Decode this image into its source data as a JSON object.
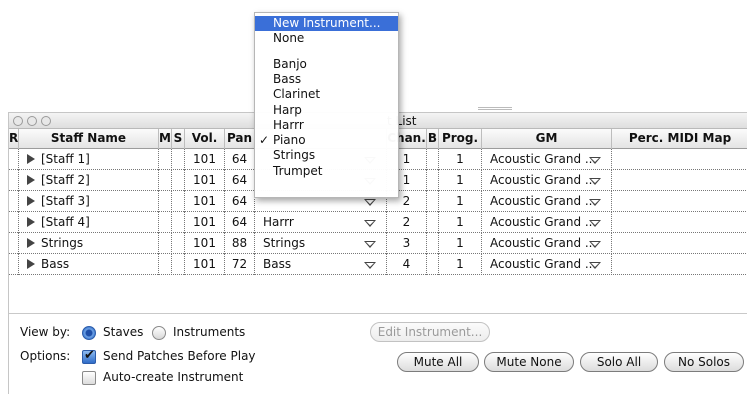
{
  "window": {
    "title": "t List"
  },
  "columns": {
    "r": "R",
    "staff_name": "Staff Name",
    "m": "M",
    "s": "S",
    "vol": "Vol.",
    "pan": "Pan",
    "chan": "Chan.",
    "b": "B",
    "prog": "Prog.",
    "gm": "GM",
    "perc": "Perc. MIDI Map"
  },
  "rows": [
    {
      "name": "[Staff 1]",
      "vol": "101",
      "pan": "64",
      "instrument": "",
      "chan": "1",
      "prog": "1",
      "gm": "Acoustic Grand ..."
    },
    {
      "name": "[Staff 2]",
      "vol": "101",
      "pan": "64",
      "instrument": "",
      "chan": "1",
      "prog": "1",
      "gm": "Acoustic Grand ..."
    },
    {
      "name": "[Staff 3]",
      "vol": "101",
      "pan": "64",
      "instrument": "",
      "chan": "2",
      "prog": "1",
      "gm": "Acoustic Grand ..."
    },
    {
      "name": "[Staff 4]",
      "vol": "101",
      "pan": "64",
      "instrument": "Harrr",
      "chan": "2",
      "prog": "1",
      "gm": "Acoustic Grand ..."
    },
    {
      "name": "Strings",
      "vol": "101",
      "pan": "88",
      "instrument": "Strings",
      "chan": "3",
      "prog": "1",
      "gm": "Acoustic Grand ..."
    },
    {
      "name": "Bass",
      "vol": "101",
      "pan": "72",
      "instrument": "Bass",
      "chan": "4",
      "prog": "1",
      "gm": "Acoustic Grand ..."
    }
  ],
  "view_by": {
    "label": "View by:",
    "staves": "Staves",
    "instruments": "Instruments",
    "selected": "staves"
  },
  "options": {
    "label": "Options:",
    "send_patches": "Send Patches Before Play",
    "send_patches_checked": true,
    "auto_create": "Auto-create Instrument",
    "auto_create_checked": false
  },
  "buttons": {
    "edit_instrument": "Edit Instrument...",
    "mute_all": "Mute All",
    "mute_none": "Mute None",
    "solo_all": "Solo All",
    "no_solos": "No Solos"
  },
  "menu": {
    "items": [
      "New Instrument...",
      "None",
      "",
      "Banjo",
      "Bass",
      "Clarinet",
      "Harp",
      "Harrr",
      "Piano",
      "Strings",
      "Trumpet"
    ],
    "highlighted": "New Instrument...",
    "checked": "Piano"
  },
  "colors": {
    "highlight": "#3a6fd8",
    "radio_selected": "#2f6cc8"
  }
}
